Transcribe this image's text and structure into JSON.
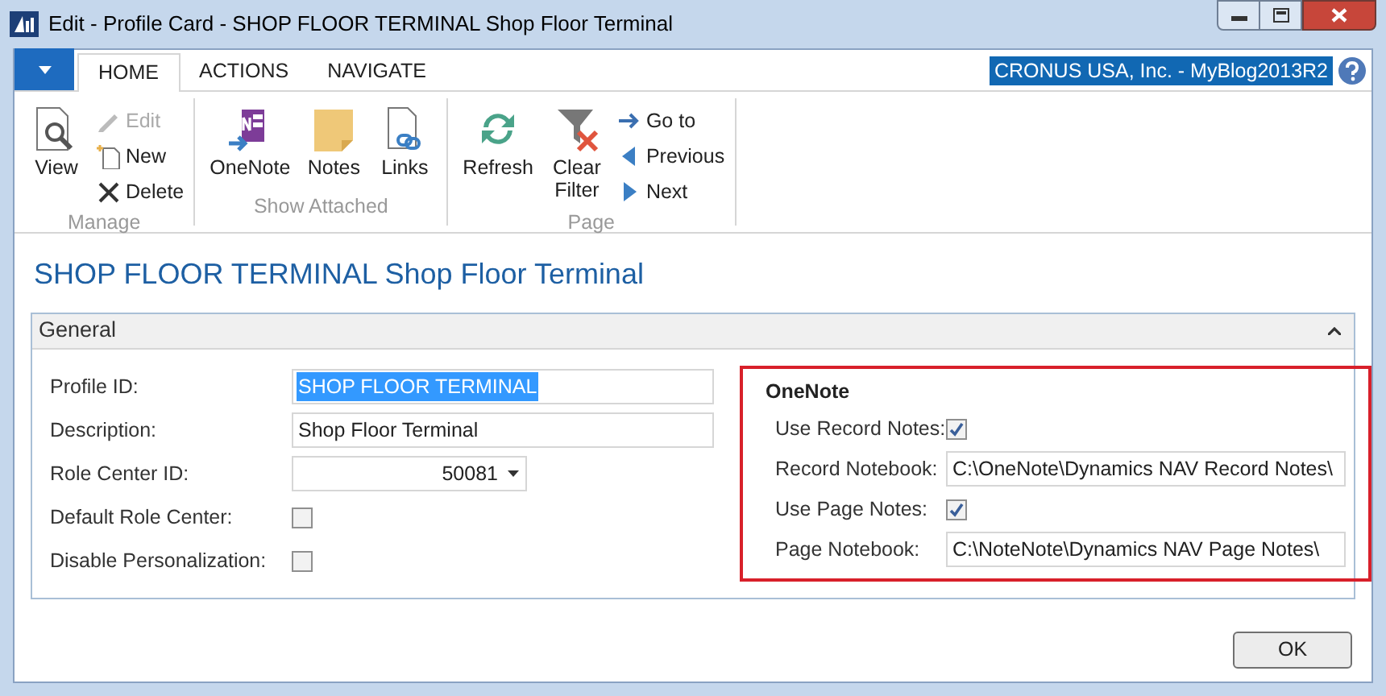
{
  "window": {
    "title": "Edit - Profile Card - SHOP FLOOR TERMINAL Shop Floor Terminal"
  },
  "ribbon": {
    "tabs": [
      {
        "label": "HOME",
        "selected": true
      },
      {
        "label": "ACTIONS",
        "selected": false
      },
      {
        "label": "NAVIGATE",
        "selected": false
      }
    ],
    "company": "CRONUS USA, Inc. - MyBlog2013R2",
    "groups": [
      {
        "label": "Manage",
        "buttons": [
          {
            "kind": "large",
            "label": "View",
            "disabled": false
          },
          {
            "kind": "small",
            "label": "Edit",
            "disabled": true
          },
          {
            "kind": "small",
            "label": "New",
            "disabled": false
          },
          {
            "kind": "small",
            "label": "Delete",
            "disabled": false
          }
        ]
      },
      {
        "label": "Show Attached",
        "buttons": [
          {
            "kind": "large",
            "label": "OneNote",
            "disabled": false
          },
          {
            "kind": "large",
            "label": "Notes",
            "disabled": false
          },
          {
            "kind": "large",
            "label": "Links",
            "disabled": false
          }
        ]
      },
      {
        "label": "Page",
        "buttons": [
          {
            "kind": "large",
            "label": "Refresh",
            "disabled": false
          },
          {
            "kind": "large",
            "label": "Clear Filter",
            "disabled": false
          },
          {
            "kind": "small",
            "label": "Go to",
            "disabled": false
          },
          {
            "kind": "small",
            "label": "Previous",
            "disabled": false
          },
          {
            "kind": "small",
            "label": "Next",
            "disabled": false
          }
        ]
      }
    ]
  },
  "page_title": "SHOP FLOOR TERMINAL Shop Floor Terminal",
  "general": {
    "title": "General",
    "expanded": true,
    "fields": [
      {
        "kind": "text",
        "label": "Profile ID:",
        "value": "SHOP FLOOR TERMINAL",
        "selected": true
      },
      {
        "kind": "text",
        "label": "Description:",
        "value": "Shop Floor Terminal",
        "selected": false
      },
      {
        "kind": "dropdown",
        "label": "Role Center ID:",
        "value": "50081"
      },
      {
        "kind": "checkbox",
        "label": "Default Role Center:",
        "checked": false
      },
      {
        "kind": "checkbox",
        "label": "Disable Personalization:",
        "checked": false
      }
    ],
    "onenote": {
      "title": "OneNote",
      "fields": [
        {
          "kind": "checkbox",
          "label": "Use Record Notes:",
          "checked": true
        },
        {
          "kind": "text",
          "label": "Record Notebook:",
          "value": "C:\\OneNote\\Dynamics NAV Record Notes\\",
          "selected": false
        },
        {
          "kind": "checkbox",
          "label": "Use Page Notes:",
          "checked": true
        },
        {
          "kind": "text",
          "label": "Page Notebook:",
          "value": "C:\\NoteNote\\Dynamics NAV Page Notes\\",
          "selected": false
        }
      ]
    }
  },
  "buttons": [
    "OK"
  ]
}
